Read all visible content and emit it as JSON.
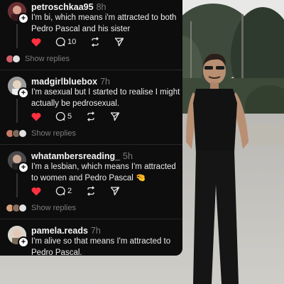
{
  "comments": [
    {
      "username": "petroschkaa95",
      "time": "8h",
      "text": "I'm bi, which means i'm attracted to both Pedro Pascal and his sister",
      "likes": "10",
      "show_replies": "Show replies"
    },
    {
      "username": "madgirlbluebox",
      "time": "7h",
      "text": "I'm asexual but I started to realise I might actually be pedrosexual.",
      "likes": "5",
      "show_replies": "Show replies"
    },
    {
      "username": "whatambersreading_",
      "time": "5h",
      "text": "I'm a lesbian, which means I'm attracted to women and Pedro Pascal",
      "emoji": "🤏",
      "likes": "2",
      "show_replies": "Show replies"
    },
    {
      "username": "pamela.reads",
      "time": "7h",
      "text": "I'm alive so that means I'm attracted to Pedro Pascal."
    }
  ],
  "colors": {
    "panel_bg": "#0d0d0d",
    "like_red": "#ff3040",
    "muted_text": "#7a7a7a"
  },
  "icons": [
    "heart-icon",
    "reply-bubble-icon",
    "repost-icon",
    "share-icon",
    "plus-icon"
  ]
}
